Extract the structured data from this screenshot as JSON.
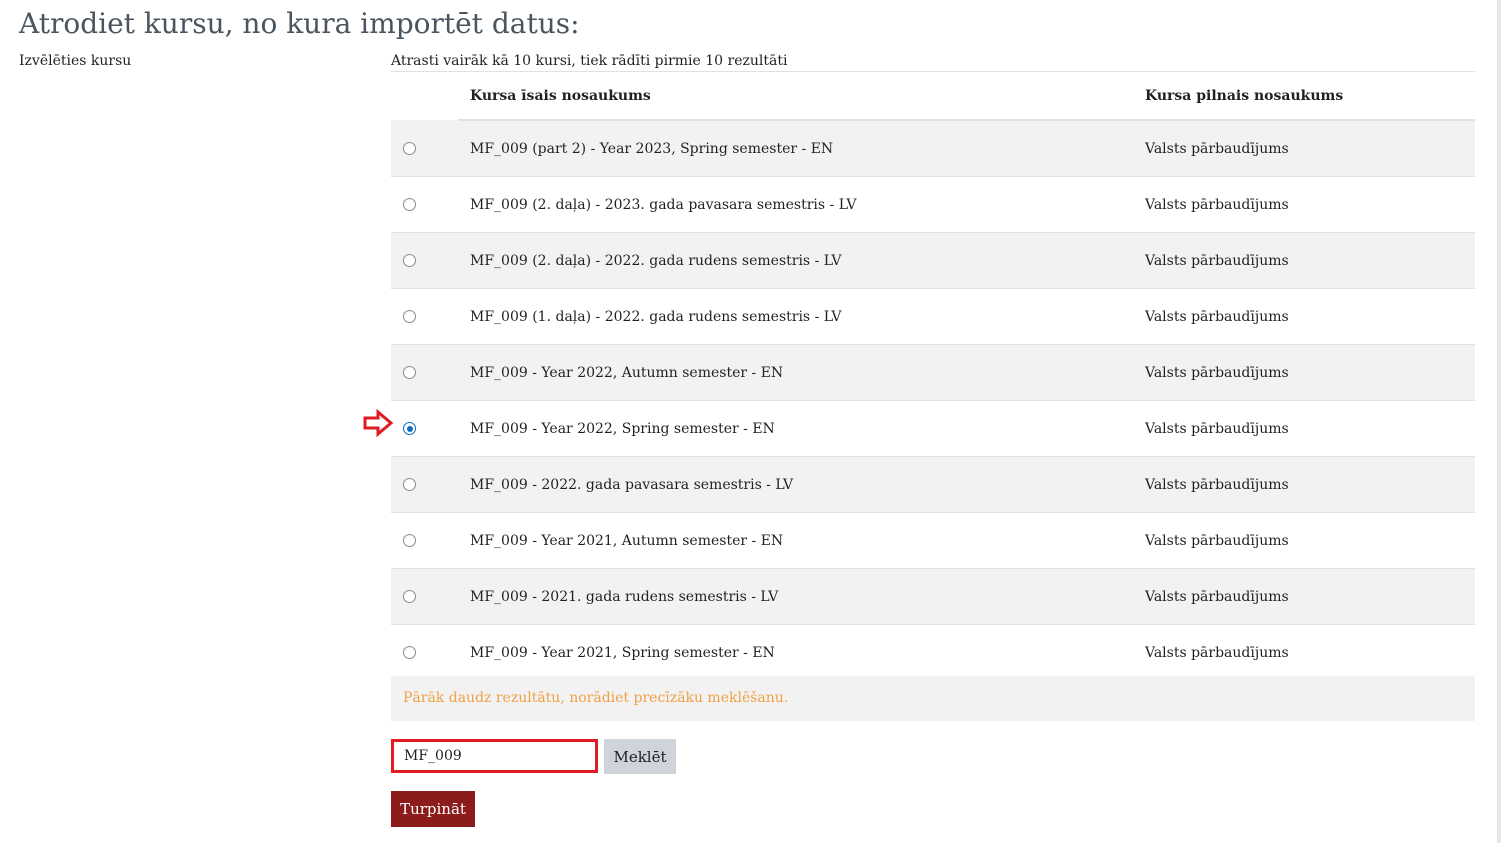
{
  "page": {
    "title": "Atrodiet kursu, no kura importēt datus:",
    "field_label": "Izvēlēties kursu",
    "results_info": "Atrasti vairāk kā 10 kursi, tiek rādīti pirmie 10 rezultāti"
  },
  "table": {
    "headers": {
      "short_name": "Kursa īsais nosaukums",
      "full_name": "Kursa pilnais nosaukums"
    },
    "rows": [
      {
        "short_name": "MF_009 (part 2) - Year 2023, Spring semester - EN",
        "full_name": "Valsts pārbaudījums",
        "selected": false
      },
      {
        "short_name": "MF_009 (2. daļa) - 2023. gada pavasara semestris - LV",
        "full_name": "Valsts pārbaudījums",
        "selected": false
      },
      {
        "short_name": "MF_009 (2. daļa) - 2022. gada rudens semestris - LV",
        "full_name": "Valsts pārbaudījums",
        "selected": false
      },
      {
        "short_name": "MF_009 (1. daļa) - 2022. gada rudens semestris - LV",
        "full_name": "Valsts pārbaudījums",
        "selected": false
      },
      {
        "short_name": "MF_009 - Year 2022, Autumn semester - EN",
        "full_name": "Valsts pārbaudījums",
        "selected": false
      },
      {
        "short_name": "MF_009 - Year 2022, Spring semester - EN",
        "full_name": "Valsts pārbaudījums",
        "selected": true
      },
      {
        "short_name": "MF_009 - 2022. gada pavasara semestris - LV",
        "full_name": "Valsts pārbaudījums",
        "selected": false
      },
      {
        "short_name": "MF_009 - Year 2021, Autumn semester - EN",
        "full_name": "Valsts pārbaudījums",
        "selected": false
      },
      {
        "short_name": "MF_009 - 2021. gada rudens semestris - LV",
        "full_name": "Valsts pārbaudījums",
        "selected": false
      },
      {
        "short_name": "MF_009 - Year 2021, Spring semester - EN",
        "full_name": "Valsts pārbaudījums",
        "selected": false
      }
    ],
    "too_many_message": "Pārāk daudz rezultātu, norādiet precīzāku meklēšanu."
  },
  "search": {
    "value": "MF_009",
    "button_label": "Meklēt"
  },
  "actions": {
    "continue_label": "Turpināt"
  },
  "icons": {
    "selection_arrow": "arrow-right-icon",
    "radio": "radio-icon"
  },
  "colors": {
    "accent_blue": "#0f6cbf",
    "highlight_red": "#e11b22",
    "primary_button": "#8c1c1c",
    "warning_text": "#f0a045",
    "row_stripe": "#f2f2f2"
  }
}
